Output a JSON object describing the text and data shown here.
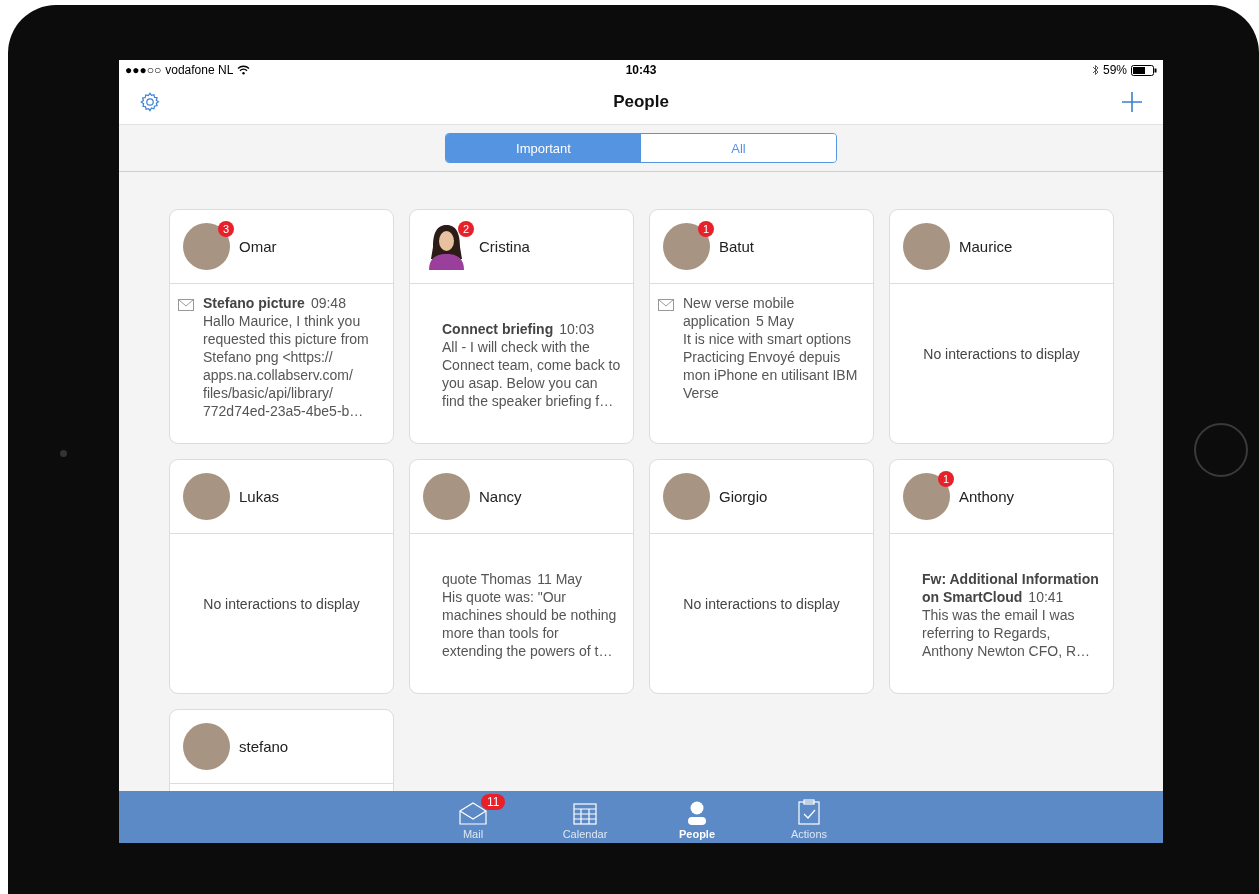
{
  "status_bar": {
    "signal": "●●●○○",
    "carrier": "vodafone NL",
    "time": "10:43",
    "battery": "59%"
  },
  "nav_bar": {
    "title": "People"
  },
  "segments": [
    {
      "label": "Important",
      "selected": true
    },
    {
      "label": "All",
      "selected": false
    }
  ],
  "people": [
    {
      "name": "Omar",
      "kind": "photo",
      "badge": "3",
      "message": {
        "mail_icon": true,
        "unread": true,
        "subject": "Stefano picture",
        "time": "09:48",
        "preview": "Hallo Maurice, I think you requested this picture from Stefano png <https:// apps.na.collabserv.com/ files/basic/api/library/ 772d74ed-23a5-4be5-b…"
      }
    },
    {
      "name": "Cristina",
      "kind": "silhouette",
      "badge": "2",
      "message": {
        "mail_icon": false,
        "unread": true,
        "subject": "Connect briefing",
        "time": "10:03",
        "preview": "All - I will check with the Connect team, come back to you asap. Below you can find the speaker briefing f…"
      }
    },
    {
      "name": "Batut",
      "kind": "photo",
      "badge": "1",
      "message": {
        "mail_icon": true,
        "unread": false,
        "subject": "New verse mobile application",
        "time": "5 May",
        "preview": "It is nice with smart options Practicing Envoyé depuis mon iPhone en utilisant IBM Verse"
      }
    },
    {
      "name": "Maurice",
      "kind": "photo",
      "empty_text": "No interactions to display"
    },
    {
      "name": "Lukas",
      "kind": "photo",
      "empty_text": "No interactions to display"
    },
    {
      "name": "Nancy",
      "kind": "photo",
      "message": {
        "mail_icon": false,
        "unread": false,
        "subject": "quote Thomas",
        "time": "11 May",
        "preview": "His quote was: \"Our machines should be nothing more than tools for extending the powers of t…"
      }
    },
    {
      "name": "Giorgio",
      "kind": "photo",
      "empty_text": "No interactions to display"
    },
    {
      "name": "Anthony",
      "kind": "photo",
      "badge": "1",
      "message": {
        "mail_icon": false,
        "unread": true,
        "subject": "Fw: Additional Information on SmartCloud",
        "time": "10:41",
        "preview": "This was the email I was referring to Regards, Anthony Newton CFO, R…"
      }
    },
    {
      "name": "stefano",
      "kind": "photo"
    }
  ],
  "tab_bar": {
    "items": [
      {
        "kind": "mail",
        "label": "Mail",
        "badge": "11",
        "selected": false
      },
      {
        "kind": "calendar",
        "label": "Calendar",
        "selected": false
      },
      {
        "kind": "people",
        "label": "People",
        "selected": true
      },
      {
        "kind": "actions",
        "label": "Actions",
        "selected": false
      }
    ]
  }
}
